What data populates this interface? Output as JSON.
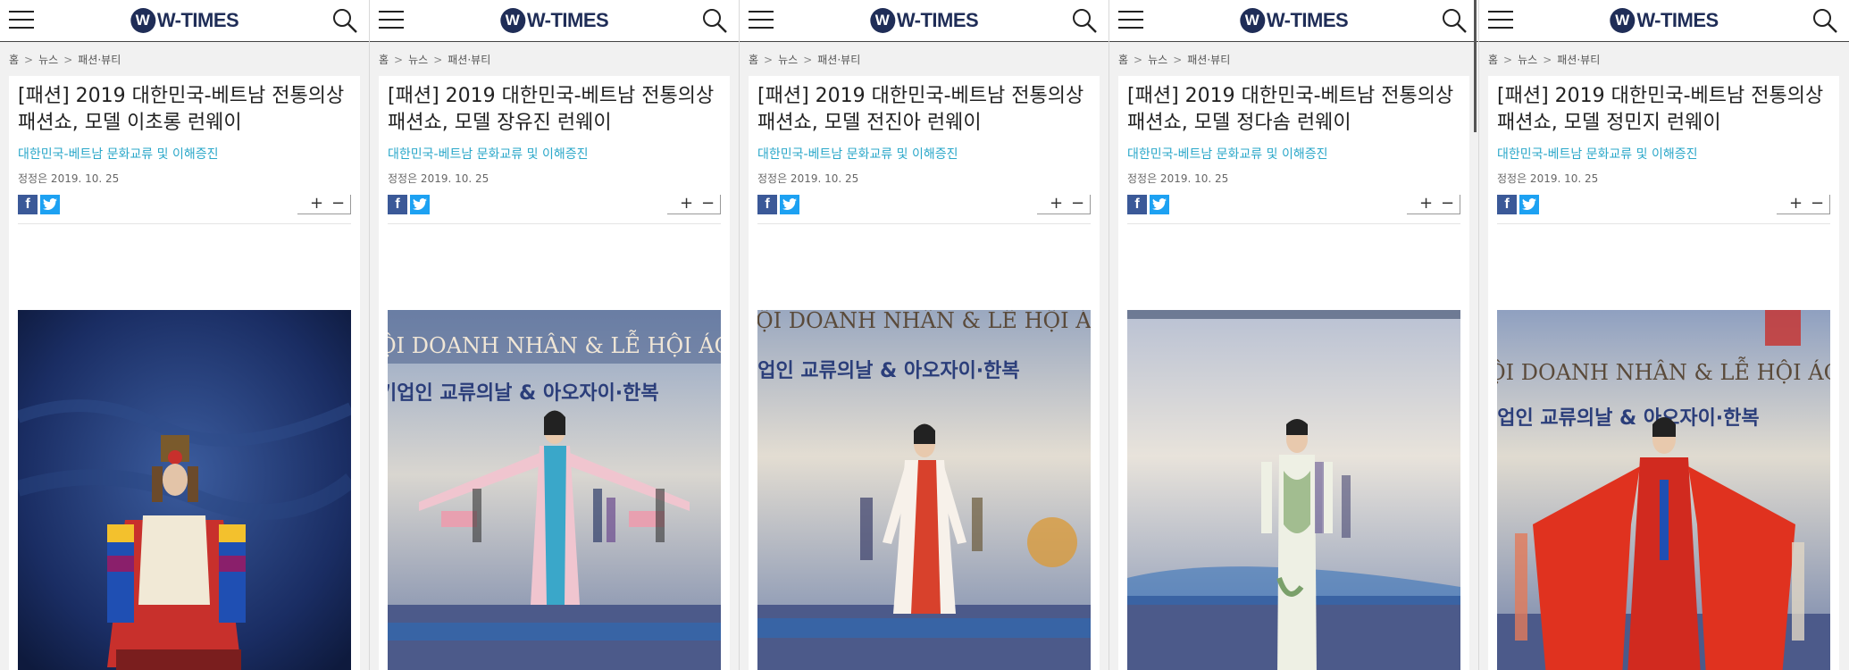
{
  "brand": {
    "logo_mark": "W",
    "logo_text": "W-TIMES"
  },
  "breadcrumb": {
    "home": "홈",
    "sep": ">",
    "news": "뉴스",
    "section": "패션·뷰티"
  },
  "article": {
    "subtitle": "대한민국-베트남 문화교류 및 이해증진",
    "date": "정정은 2019. 10. 25",
    "share_fb": "f",
    "zoom_in": "+",
    "zoom_out": "−"
  },
  "panels": [
    {
      "title": "[패션] 2019 대한민국-베트남 전통의상 패션쇼, 모델 이초롱 런웨이"
    },
    {
      "title": "[패션] 2019 대한민국-베트남 전통의상 패션쇼, 모델 장유진 런웨이"
    },
    {
      "title": "[패션] 2019 대한민국-베트남 전통의상 패션쇼, 모델 전진아 런웨이"
    },
    {
      "title": "[패션] 2019 대한민국-베트남 전통의상 패션쇼, 모델 정다솜 런웨이"
    },
    {
      "title": "[패션] 2019 대한민국-베트남 전통의상 패션쇼, 모델 정민지 런웨이"
    }
  ],
  "banner": {
    "line1": "ỘI DOANH NHÂN & LỄ HỘI ÁO",
    "line2": "기업인 교류의날 & 아오자이·한복"
  },
  "icons": {
    "menu": "hamburger-menu-icon",
    "search": "search-icon",
    "facebook": "facebook-icon",
    "twitter": "twitter-icon"
  },
  "colors": {
    "brand": "#1f2d57",
    "accent": "#2aa7c9",
    "facebook": "#3b5998",
    "twitter": "#1da1f2"
  }
}
